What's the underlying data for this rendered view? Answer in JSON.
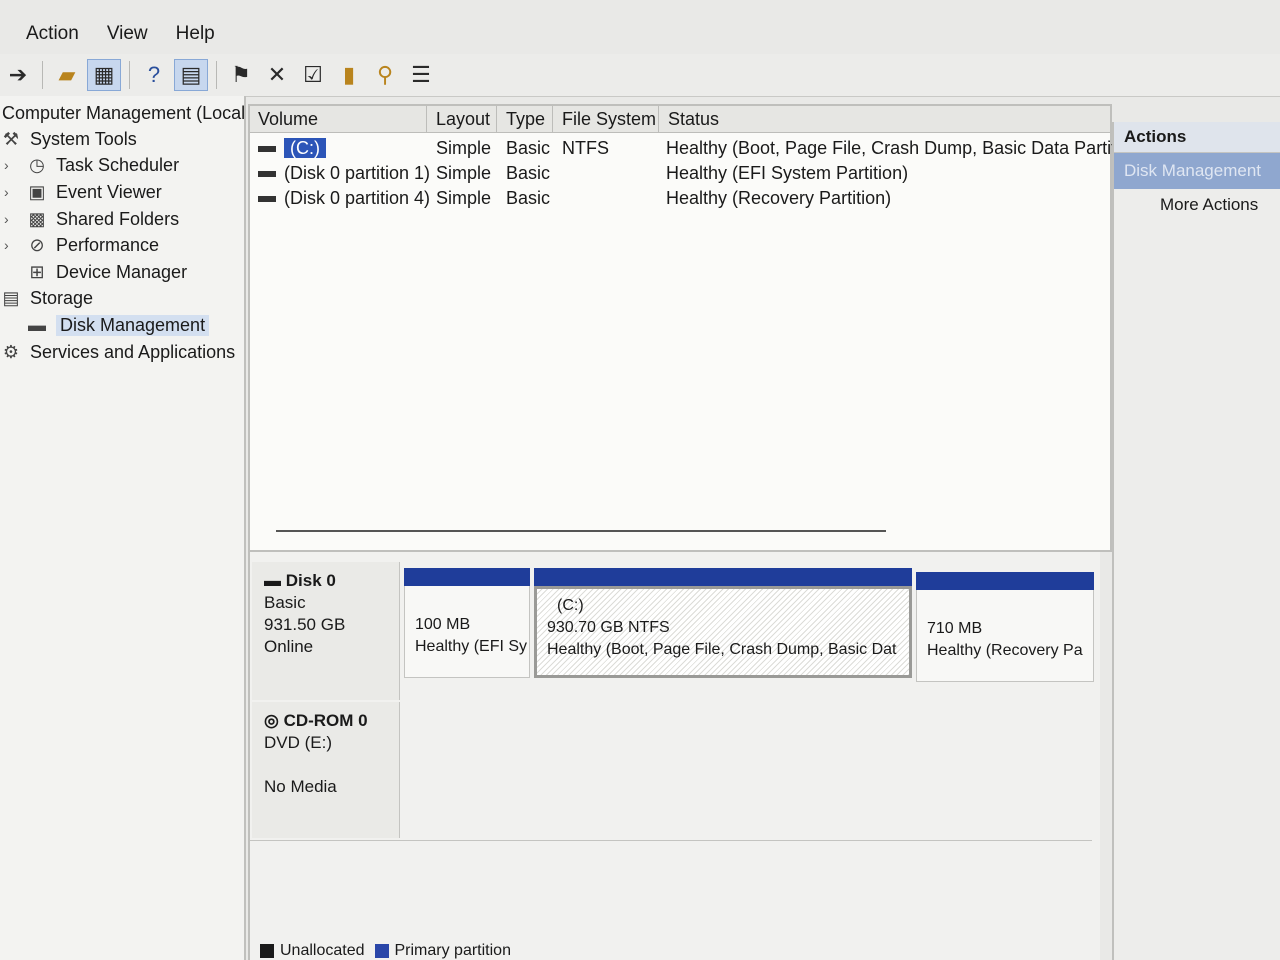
{
  "menu": [
    "Action",
    "View",
    "Help"
  ],
  "toolbar_icons": [
    "forward-arrow-icon",
    "folder-up-icon",
    "console-tree-icon",
    "help-icon",
    "show-hide-pane-icon",
    "connect-icon",
    "delete-icon",
    "properties-icon",
    "disk-settings-icon",
    "search-icon",
    "list-icon"
  ],
  "tree": {
    "root": "Computer Management (Local",
    "system_tools": "System Tools",
    "task_scheduler": "Task Scheduler",
    "event_viewer": "Event Viewer",
    "shared_folders": "Shared Folders",
    "performance": "Performance",
    "device_manager": "Device Manager",
    "storage": "Storage",
    "disk_management": "Disk Management",
    "services": "Services and Applications"
  },
  "volumes": {
    "columns": [
      "Volume",
      "Layout",
      "Type",
      "File System",
      "Status"
    ],
    "rows": [
      {
        "volume": "(C:)",
        "layout": "Simple",
        "type": "Basic",
        "fs": "NTFS",
        "status": "Healthy (Boot, Page File, Crash Dump, Basic Data Partition)"
      },
      {
        "volume": "(Disk 0 partition 1)",
        "layout": "Simple",
        "type": "Basic",
        "fs": "",
        "status": "Healthy (EFI System Partition)"
      },
      {
        "volume": "(Disk 0 partition 4)",
        "layout": "Simple",
        "type": "Basic",
        "fs": "",
        "status": "Healthy (Recovery Partition)"
      }
    ]
  },
  "disk0": {
    "title": "Disk 0",
    "kind": "Basic",
    "size": "931.50 GB",
    "state": "Online",
    "partitions": [
      {
        "line1": "",
        "line2": "100 MB",
        "line3": "Healthy (EFI Sy"
      },
      {
        "line1": "(C:)",
        "line2": "930.70 GB NTFS",
        "line3": "Healthy (Boot, Page File, Crash Dump, Basic Dat"
      },
      {
        "line1": "",
        "line2": "710 MB",
        "line3": "Healthy (Recovery Pa"
      }
    ]
  },
  "cdrom": {
    "title": "CD-ROM 0",
    "drive": "DVD (E:)",
    "media": "No Media"
  },
  "legend": {
    "unallocated": "Unallocated",
    "primary": "Primary partition",
    "unallocated_color": "#1a1a1a",
    "primary_color": "#2a46a8"
  },
  "actions": {
    "header": "Actions",
    "section": "Disk Management",
    "more": "More Actions"
  }
}
